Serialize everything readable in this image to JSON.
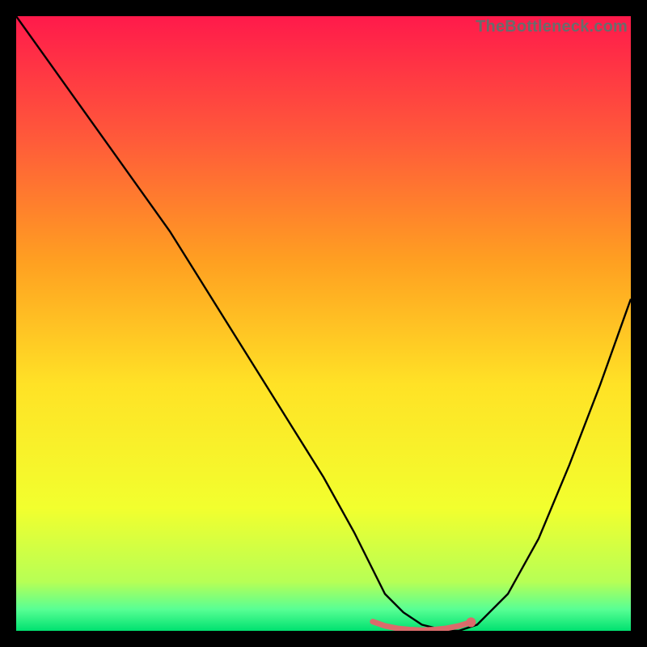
{
  "watermark": "TheBottleneck.com",
  "chart_data": {
    "type": "line",
    "title": "",
    "xlabel": "",
    "ylabel": "",
    "xlim": [
      0,
      100
    ],
    "ylim": [
      0,
      100
    ],
    "gradient_stops": [
      {
        "offset": 0.0,
        "color": "#ff1a4b"
      },
      {
        "offset": 0.2,
        "color": "#ff5a3a"
      },
      {
        "offset": 0.4,
        "color": "#ffa021"
      },
      {
        "offset": 0.6,
        "color": "#ffe226"
      },
      {
        "offset": 0.8,
        "color": "#f2ff2e"
      },
      {
        "offset": 0.92,
        "color": "#b7ff55"
      },
      {
        "offset": 0.965,
        "color": "#58ff94"
      },
      {
        "offset": 1.0,
        "color": "#00e170"
      }
    ],
    "series": [
      {
        "name": "bottleneck-curve",
        "color": "#000000",
        "x": [
          0,
          5,
          10,
          15,
          20,
          25,
          30,
          35,
          40,
          45,
          50,
          55,
          58,
          60,
          63,
          66,
          70,
          72,
          75,
          80,
          85,
          90,
          95,
          100
        ],
        "y": [
          100,
          93,
          86,
          79,
          72,
          65,
          57,
          49,
          41,
          33,
          25,
          16,
          10,
          6,
          3,
          1,
          0,
          0,
          1,
          6,
          15,
          27,
          40,
          54
        ]
      },
      {
        "name": "optimal-band",
        "color": "#db6b6b",
        "x": [
          58,
          60,
          62,
          64,
          66,
          68,
          70,
          72,
          74
        ],
        "y": [
          1.5,
          0.8,
          0.4,
          0.2,
          0.1,
          0.2,
          0.4,
          0.8,
          1.4
        ]
      }
    ],
    "marker": {
      "x": 74,
      "y": 1.4,
      "color": "#db6b6b"
    }
  }
}
